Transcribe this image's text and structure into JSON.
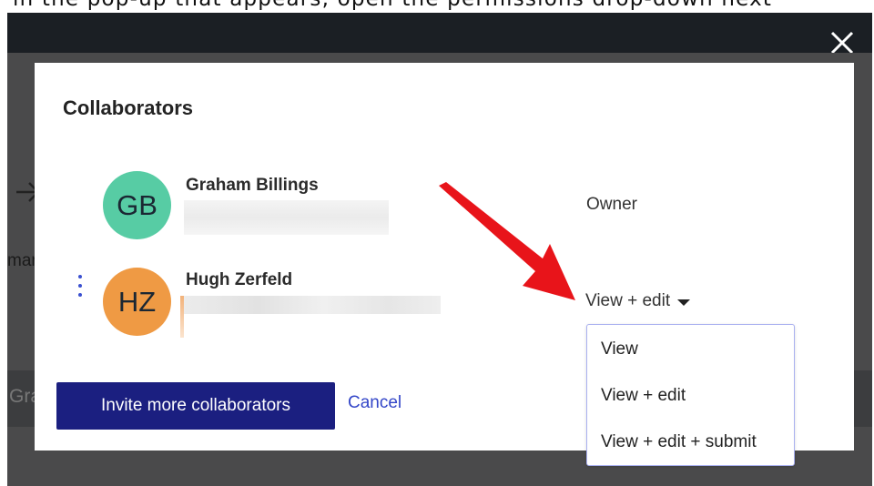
{
  "instruction_text": "in the pop-up that appears, open the permissions drop-down next",
  "background": {
    "partial_text_left": "mar",
    "partial_button_text": "Gra"
  },
  "modal": {
    "title": "Collaborators",
    "collaborators": [
      {
        "initials": "GB",
        "name": "Graham Billings",
        "role": "Owner",
        "avatar_color": "#57cca4"
      },
      {
        "initials": "HZ",
        "name": "Hugh Zerfeld",
        "permission": "View + edit",
        "avatar_color": "#ef9a44"
      }
    ],
    "invite_button": "Invite more collaborators",
    "cancel_link": "Cancel"
  },
  "permission_menu": {
    "options": [
      "View",
      "View + edit",
      "View + edit + submit"
    ]
  },
  "colors": {
    "primary": "#1b1f80",
    "link": "#3346c8",
    "annotation": "#e8141a"
  }
}
